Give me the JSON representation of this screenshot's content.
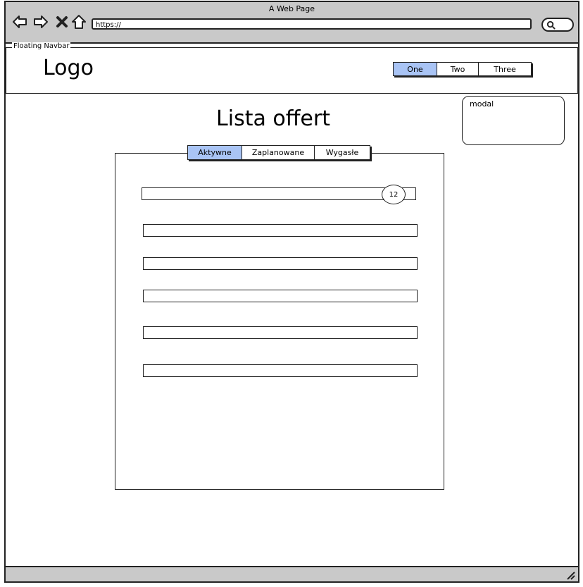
{
  "window": {
    "title": "A Web Page"
  },
  "browser": {
    "url": "https://",
    "icons": [
      "back-arrow-icon",
      "forward-arrow-icon",
      "close-x-icon",
      "home-icon",
      "search-icon"
    ]
  },
  "navbar": {
    "label": "Floating Navbar",
    "logo": "Logo",
    "buttons": [
      {
        "label": "One",
        "active": true
      },
      {
        "label": "Two",
        "active": false
      },
      {
        "label": "Three",
        "active": false
      }
    ]
  },
  "modal": {
    "label": "modal"
  },
  "main": {
    "title": "Lista offert",
    "tabs": [
      {
        "label": "Aktywne",
        "active": true
      },
      {
        "label": "Zaplanowane",
        "active": false
      },
      {
        "label": "Wygasłe",
        "active": false
      }
    ],
    "badge": "12"
  },
  "colors": {
    "active": "#a9c4f5",
    "chrome": "#c9c9c9"
  }
}
